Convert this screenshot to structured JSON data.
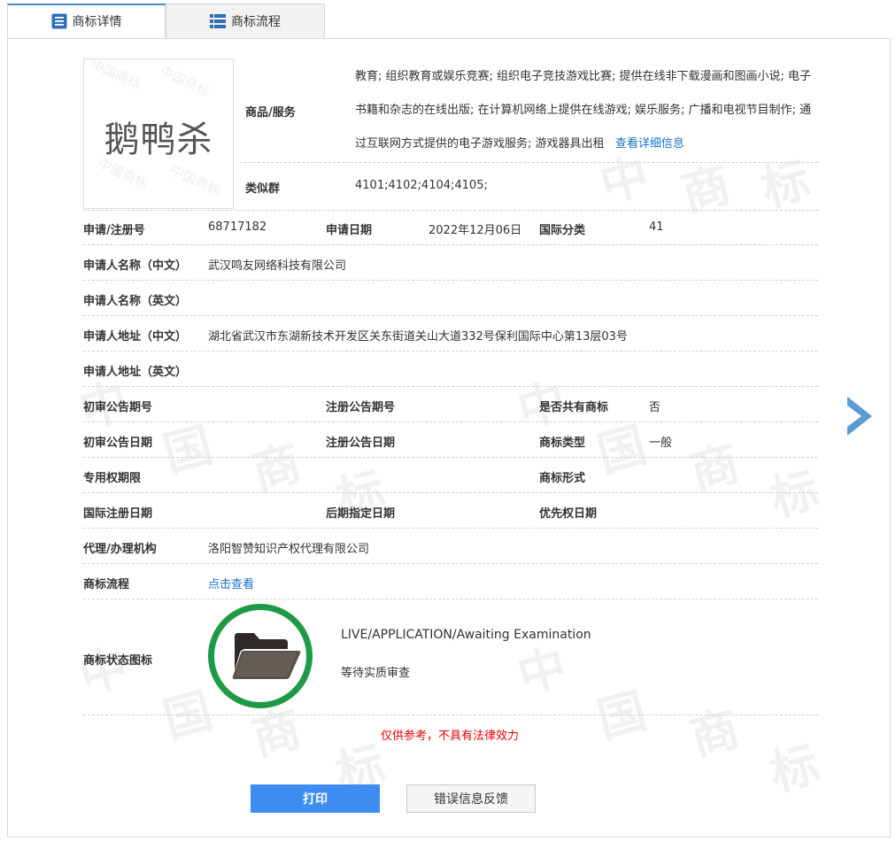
{
  "tabs": [
    {
      "label": "商标详情",
      "icon": "list-icon"
    },
    {
      "label": "商标流程",
      "icon": "grid-list-icon"
    }
  ],
  "trademark_image": {
    "text": "鹅鸭杀",
    "watermark": "中国商标"
  },
  "goods": {
    "label": "商品/服务",
    "text": "教育; 组织教育或娱乐竞赛; 组织电子竞技游戏比赛; 提供在线非下载漫画和图画小说; 电子书籍和杂志的在线出版; 在计算机网络上提供在线游戏; 娱乐服务; 广播和电视节目制作; 通过互联网方式提供的电子游戏服务; 游戏器具出租",
    "detail_link": "查看详细信息"
  },
  "similar_group": {
    "label": "类似群",
    "value": "4101;4102;4104;4105;"
  },
  "fields": {
    "reg_no_label": "申请/注册号",
    "reg_no": "68717182",
    "app_date_label": "申请日期",
    "app_date": "2022年12月06日",
    "intl_class_label": "国际分类",
    "intl_class": "41",
    "applicant_cn_label": "申请人名称（中文）",
    "applicant_cn": "武汉鸣友网络科技有限公司",
    "applicant_en_label": "申请人名称（英文）",
    "applicant_en": "",
    "address_cn_label": "申请人地址（中文）",
    "address_cn": "湖北省武汉市东湖新技术开发区关东街道关山大道332号保利国际中心第13层03号",
    "address_en_label": "申请人地址（英文）",
    "address_en": "",
    "prelim_no_label": "初审公告期号",
    "prelim_no": "",
    "reg_pub_no_label": "注册公告期号",
    "reg_pub_no": "",
    "shared_label": "是否共有商标",
    "shared": "否",
    "prelim_date_label": "初审公告日期",
    "prelim_date": "",
    "reg_pub_date_label": "注册公告日期",
    "reg_pub_date": "",
    "tm_type_label": "商标类型",
    "tm_type": "一般",
    "exclusive_label": "专用权期限",
    "exclusive": "",
    "tm_form_label": "商标形式",
    "tm_form": "",
    "intl_reg_date_label": "国际注册日期",
    "intl_reg_date": "",
    "later_date_label": "后期指定日期",
    "later_date": "",
    "priority_date_label": "优先权日期",
    "priority_date": "",
    "agent_label": "代理/办理机构",
    "agent": "洛阳智赞知识产权代理有限公司",
    "process_label": "商标流程",
    "process_link": "点击查看"
  },
  "status": {
    "label": "商标状态图标",
    "icon": "folder-icon",
    "en": "LIVE/APPLICATION/Awaiting Examination",
    "cn": "等待实质审查",
    "ring_color": "#1e9a46"
  },
  "disclaimer": "仅供参考，不具有法律效力",
  "buttons": {
    "print": "打印",
    "feedback": "错误信息反馈"
  },
  "colors": {
    "accent": "#3d8ef0",
    "link": "#1a73c9",
    "warning": "#e60000",
    "arrow": "#5b9bd5"
  }
}
